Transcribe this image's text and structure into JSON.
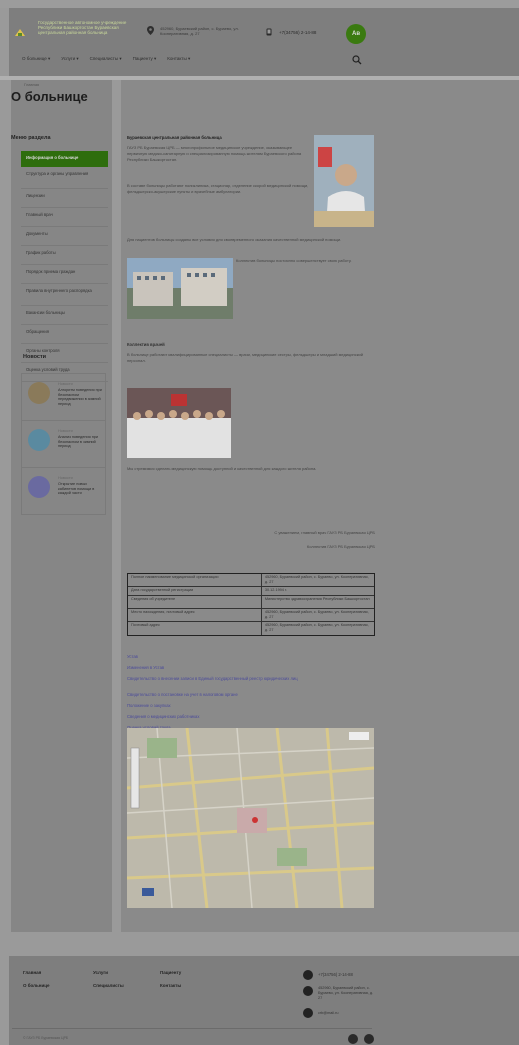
{
  "header": {
    "org_name": "Государственное автономное учреждение Республики Башкортостан Бураевская центральная районная больница",
    "address": "452960, Бураевский район, с. Бураево, ул. Кооперативная, д. 27",
    "phone": "+7(34756) 2-14-88",
    "accessibility_badge": "Ав",
    "nav": [
      "О больнице ▾",
      "Услуги ▾",
      "Специалисты ▾",
      "Пациенту ▾",
      "Контакты ▾"
    ]
  },
  "page": {
    "breadcrumb": "Главная",
    "title": "О больнице"
  },
  "sidebar": {
    "menu_title": "Меню раздела",
    "items": [
      "Информация о больнице",
      "Структура и органы управления",
      "Лицензии",
      "Главный врач",
      "Документы",
      "График работы",
      "Порядок приема граждан",
      "Правила внутреннего распорядка",
      "Вакансии больницы",
      "Обращения",
      "Органы контроля",
      "Оценка условий труда"
    ],
    "news_title": "Новости",
    "news": [
      {
        "date": "Новости",
        "title": "Алгоритм поведения при безопасном передвижении в зимний период"
      },
      {
        "date": "Новости",
        "title": "Анализ поведения при безопасном в зимний период"
      },
      {
        "date": "Новости",
        "title": "Открытие новых кабинетов помощи в каждой части"
      }
    ]
  },
  "content": {
    "title": "Бураевская центральная районная больница",
    "para1": "ГАУЗ РБ Бураевская ЦРБ — многопрофильное медицинское учреждение, оказывающее первичную медико-санитарную и специализированную помощь жителям Бураевского района Республики Башкортостан.",
    "para2": "В составе больницы работают поликлиника, стационар, отделение скорой медицинской помощи, фельдшерско-акушерские пункты и врачебные амбулатории.",
    "para3": "Для пациентов больницы созданы все условия для своевременного оказания качественной медицинской помощи.",
    "para4": "Коллектив больницы постоянно совершенствует свою работу.",
    "section_b": "Коллектив врачей",
    "para5": "В больнице работают квалифицированные специалисты — врачи, медицинские сестры, фельдшеры и младший медицинский персонал.",
    "para6": "Мы стремимся сделать медицинскую помощь доступной и качественной для каждого жителя района.",
    "sign1": "С уважением, главный врач ГАУЗ РБ Бураевская ЦРБ",
    "sign2": "Коллектив ГАУЗ РБ Бураевская ЦРБ",
    "table": [
      {
        "k": "Полное наименование медицинской организации",
        "v": "452960, Бураевский район, с. Бураево, ул. Кооперативная, д. 27"
      },
      {
        "k": "Дата государственной регистрации",
        "v": "30.12.1994 г."
      },
      {
        "k": "Сведения об учредителе",
        "v": "Министерство здравоохранения Республики Башкортостан"
      },
      {
        "k": "Место нахождения, почтовый адрес",
        "v": "452960, Бураевский район, с. Бураево, ул. Кооперативная, д. 27"
      },
      {
        "k": "Почтовый адрес",
        "v": "452960, Бураевский район, с. Бураево, ул. Кооперативная, д. 27"
      }
    ],
    "links": [
      "Устав",
      "Изменения в Устав",
      "Свидетельство о внесении записи в Единый государственный реестр юридических лиц",
      "Свидетельство о постановке на учет в налоговом органе",
      "Положение о закупках",
      "Сведения о медицинских работниках",
      "Оценка условий труда"
    ]
  },
  "footer": {
    "links": [
      "Главная",
      "О больнице",
      "Услуги",
      "Специалисты",
      "Пациенту",
      "Контакты"
    ],
    "phone": "+7(34756) 2-14-88",
    "address": "452960, Бураевский район, с. Бураево, ул. Кооперативная, д. 27",
    "email": "crb@mail.ru",
    "copyright": "© ГАУЗ РБ Бураевская ЦРБ"
  }
}
